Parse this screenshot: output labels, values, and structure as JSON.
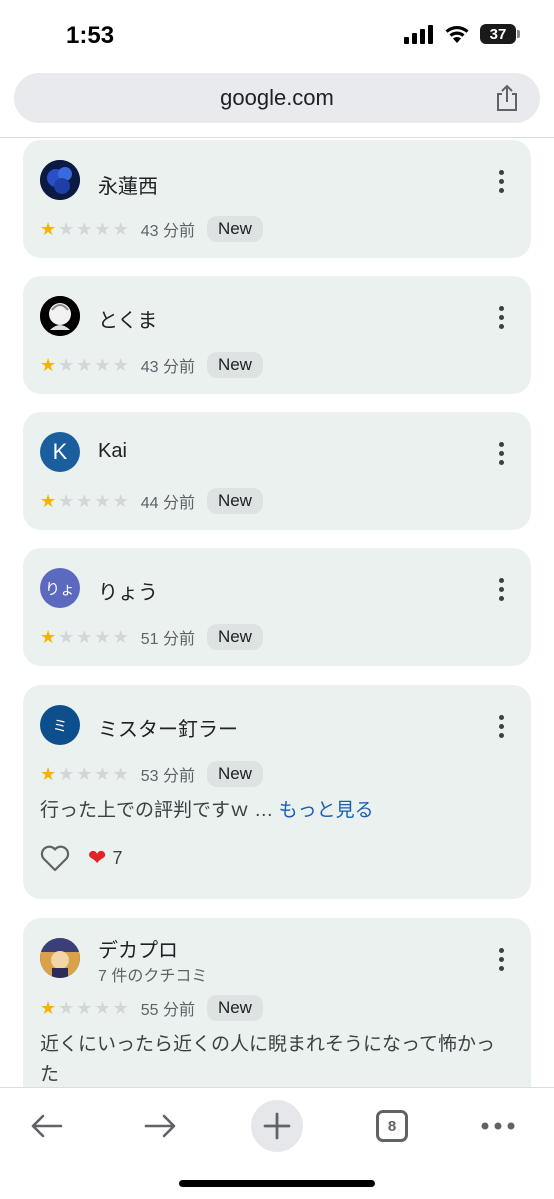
{
  "status": {
    "time": "1:53",
    "battery": "37"
  },
  "browser": {
    "url": "google.com",
    "tab_count": "8"
  },
  "reviews": [
    {
      "name": "永蓮西",
      "time": "43 分前",
      "badge": "New",
      "stars": 1
    },
    {
      "name": "とくま",
      "time": "43 分前",
      "badge": "New",
      "stars": 1
    },
    {
      "name": "Kai",
      "avatar_letter": "K",
      "time": "44 分前",
      "badge": "New",
      "stars": 1
    },
    {
      "name": "りょう",
      "avatar_letter": "りょ",
      "time": "51 分前",
      "badge": "New",
      "stars": 1
    },
    {
      "name": "ミスター釘ラー",
      "avatar_letter": "ミ",
      "time": "53 分前",
      "badge": "New",
      "stars": 1,
      "text": "行った上での評判ですｗ … ",
      "more_link": "もっと見る",
      "reaction_count": "7"
    },
    {
      "name": "デカプロ",
      "sub": "7 件のクチコミ",
      "time": "55 分前",
      "badge": "New",
      "stars": 1,
      "text": "近くにいったら近くの人に睨まれそうになって怖かった"
    }
  ],
  "colors": {
    "card_bg": "#eaf1ef",
    "star_on": "#f6b400",
    "link": "#1a5fb4",
    "avatar_kai": "#1b5e9e",
    "avatar_ryou": "#5b6abf",
    "avatar_mister": "#0d4f8c"
  }
}
